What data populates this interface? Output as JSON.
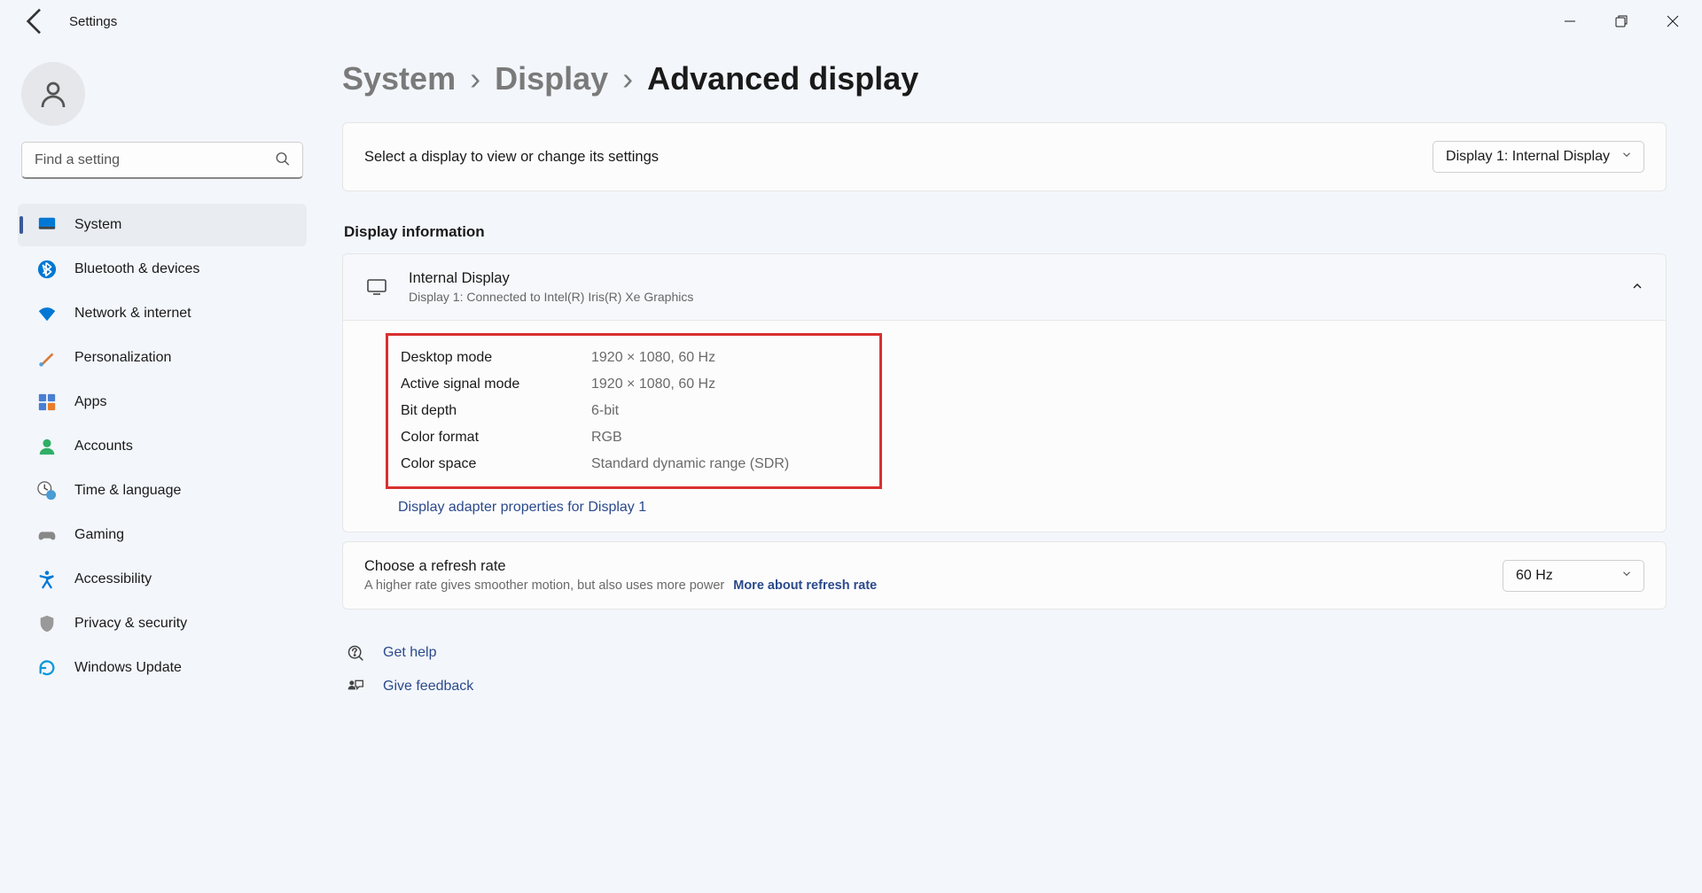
{
  "window": {
    "title": "Settings"
  },
  "search": {
    "placeholder": "Find a setting"
  },
  "nav": {
    "items": [
      {
        "label": "System",
        "active": true
      },
      {
        "label": "Bluetooth & devices"
      },
      {
        "label": "Network & internet"
      },
      {
        "label": "Personalization"
      },
      {
        "label": "Apps"
      },
      {
        "label": "Accounts"
      },
      {
        "label": "Time & language"
      },
      {
        "label": "Gaming"
      },
      {
        "label": "Accessibility"
      },
      {
        "label": "Privacy & security"
      },
      {
        "label": "Windows Update"
      }
    ]
  },
  "breadcrumb": {
    "level1": "System",
    "level2": "Display",
    "current": "Advanced display"
  },
  "selectDisplay": {
    "label": "Select a display to view or change its settings",
    "value": "Display 1: Internal Display"
  },
  "displayInfoTitle": "Display information",
  "panel": {
    "title": "Internal Display",
    "subtitle": "Display 1: Connected to Intel(R) Iris(R) Xe Graphics"
  },
  "properties": [
    {
      "k": "Desktop mode",
      "v": "1920 × 1080, 60 Hz"
    },
    {
      "k": "Active signal mode",
      "v": "1920 × 1080, 60 Hz"
    },
    {
      "k": "Bit depth",
      "v": "6-bit"
    },
    {
      "k": "Color format",
      "v": "RGB"
    },
    {
      "k": "Color space",
      "v": "Standard dynamic range (SDR)"
    }
  ],
  "adapterLink": "Display adapter properties for Display 1",
  "refresh": {
    "title": "Choose a refresh rate",
    "subtitle": "A higher rate gives smoother motion, but also uses more power",
    "more": "More about refresh rate",
    "value": "60 Hz"
  },
  "footer": {
    "help": "Get help",
    "feedback": "Give feedback"
  }
}
